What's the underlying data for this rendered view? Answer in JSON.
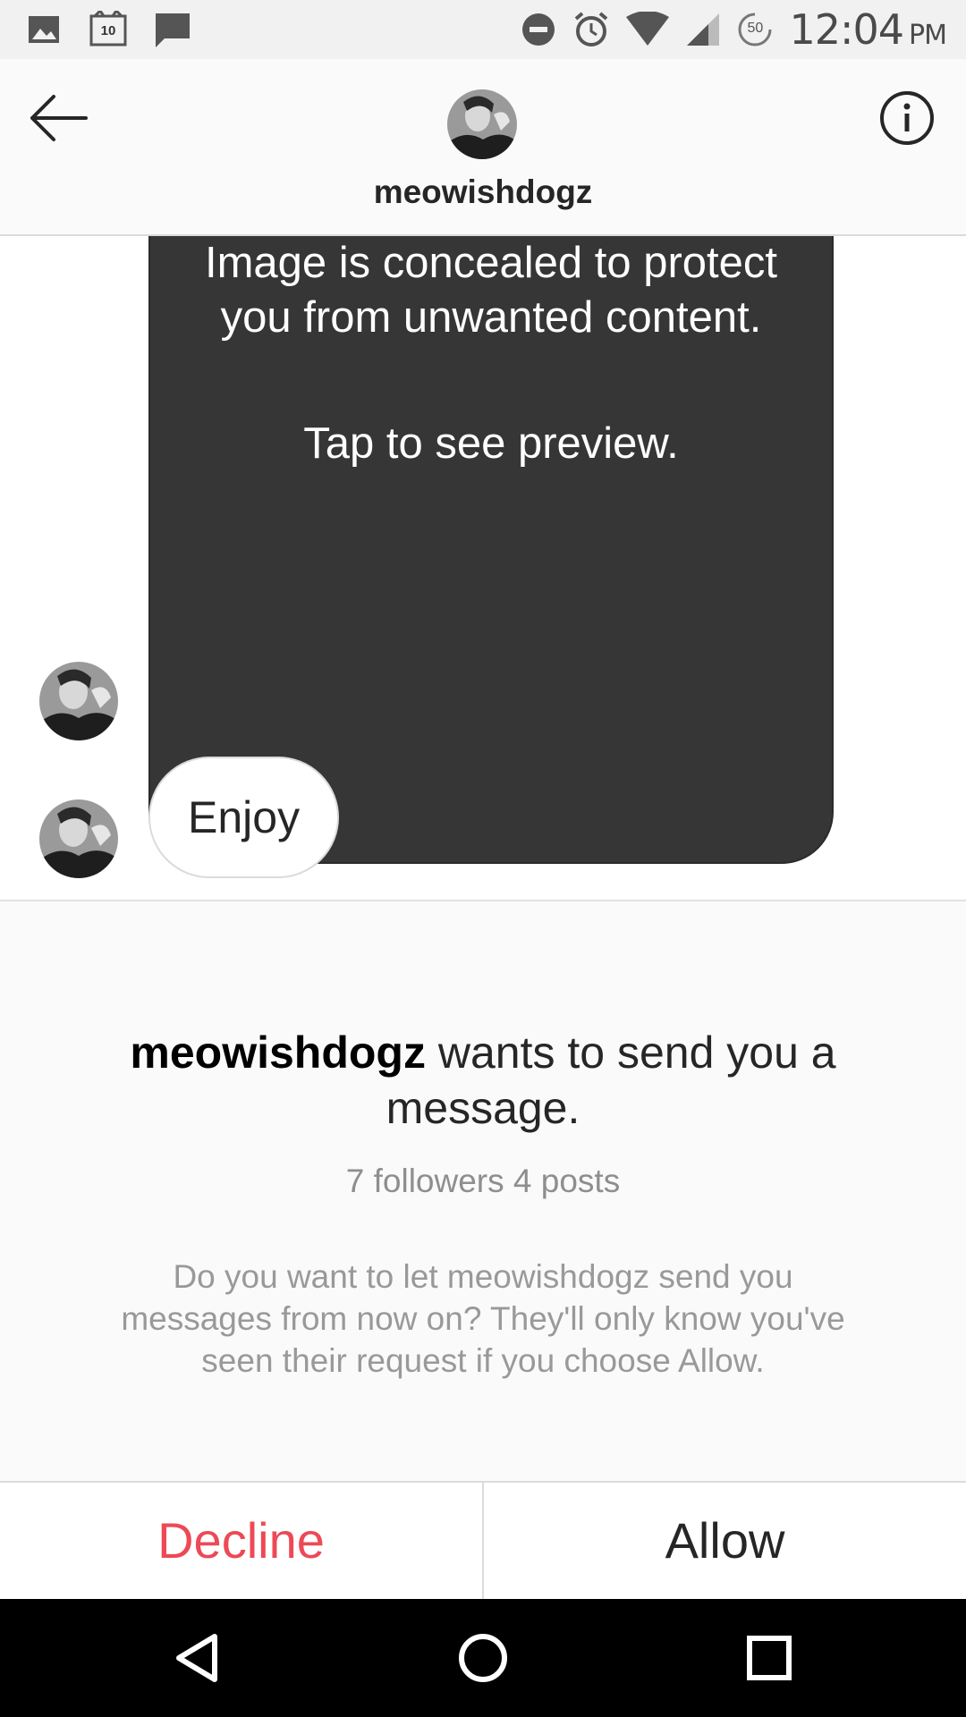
{
  "status_bar": {
    "time": "12:04",
    "ampm": "PM",
    "notification_count": "10",
    "battery_level": "50",
    "icons": [
      "image-icon",
      "cat-notification-icon",
      "message-icon",
      "do-not-disturb-icon",
      "alarm-icon",
      "wifi-icon",
      "signal-icon",
      "battery-saver-icon"
    ]
  },
  "header": {
    "username": "meowishdogz",
    "back_icon": "arrow-left-icon",
    "info_icon": "info-icon"
  },
  "thread": {
    "concealed_text": "Image is concealed to protect you from unwanted content.",
    "tap_text": "Tap to see preview.",
    "message": "Enjoy"
  },
  "request": {
    "username": "meowishdogz",
    "title_rest": " wants to send you a message.",
    "stats": "7 followers 4 posts",
    "body": "Do you want to let meowishdogz send you messages from now on? They'll only know you've seen their request if you choose Allow."
  },
  "actions": {
    "decline": "Decline",
    "allow": "Allow"
  },
  "colors": {
    "decline": "#ed4956",
    "concealed_bg": "#363636"
  }
}
